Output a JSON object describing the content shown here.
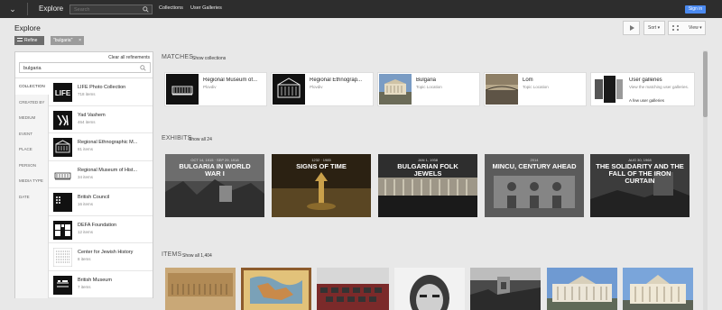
{
  "topbar": {
    "title": "Explore",
    "search_placeholder": "Search",
    "nav": [
      "Collections",
      "User Galleries"
    ],
    "signin": "Sign in"
  },
  "header": {
    "page_title": "Explore",
    "refine_label": "Refine",
    "chip_label": "\"bulgaria\"",
    "chip_close": "×",
    "sort_label": "Sort",
    "view_label": "View"
  },
  "sidebar": {
    "clear_all": "Clear all refinements",
    "filter_value": "bulgaria",
    "categories": [
      "COLLECTION",
      "CREATED BY",
      "MEDIUM",
      "EVENT",
      "PLACE",
      "PERSON",
      "MEDIA TYPE",
      "DATE"
    ],
    "results": [
      {
        "name": "LIFE Photo Collection",
        "count": "718 items",
        "logo": "LIFE"
      },
      {
        "name": "Yad Vashem",
        "count": "464 items",
        "logo": "yad"
      },
      {
        "name": "Regional Ethnographic M...",
        "count": "81 items",
        "logo": "building"
      },
      {
        "name": "Regional Museum of Hist...",
        "count": "34 items",
        "logo": "building2"
      },
      {
        "name": "British Council",
        "count": "16 items",
        "logo": "bc"
      },
      {
        "name": "DEFA Foundation",
        "count": "12 items",
        "logo": "defa"
      },
      {
        "name": "Center for Jewish History",
        "count": "8 items",
        "logo": "cjh"
      },
      {
        "name": "British Museum",
        "count": "7 items",
        "logo": "bm"
      }
    ]
  },
  "matches": {
    "title": "MATCHES",
    "link": "Show collections",
    "cards": [
      {
        "title": "Regional Museum of...",
        "sub": "Plovdiv",
        "more": ""
      },
      {
        "title": "Regional Ethnograp...",
        "sub": "Plovdiv",
        "more": ""
      },
      {
        "title": "Bulgaria",
        "sub": "Topic Location",
        "more": ""
      },
      {
        "title": "Lom",
        "sub": "Topic Location",
        "more": ""
      },
      {
        "title": "User galleries",
        "sub": "View the matching user galleries.",
        "more": "A few user galleries"
      }
    ]
  },
  "exhibits": {
    "title": "EXHIBITS",
    "link": "Show all 24",
    "cards": [
      {
        "date": "OCT 14, 1915 · SEP 29, 1918",
        "title": "BULGARIA IN WORLD WAR I"
      },
      {
        "date": "1232 · 1985",
        "title": "SIGNS OF TIME"
      },
      {
        "date": "JAN 1, 1938",
        "title": "BULGARIAN FOLK JEWELS"
      },
      {
        "date": "2014",
        "title": "MINCU, CENTURY AHEAD"
      },
      {
        "date": "AUG 30, 1968",
        "title": "THE SOLIDARITY AND THE FALL OF THE IRON CURTAIN"
      }
    ]
  },
  "items": {
    "title": "ITEMS",
    "link": "Show all 1,404"
  },
  "colors": {
    "topbar": "#2d2d2d",
    "signin": "#4b8af0",
    "background": "#e8e8e8"
  }
}
